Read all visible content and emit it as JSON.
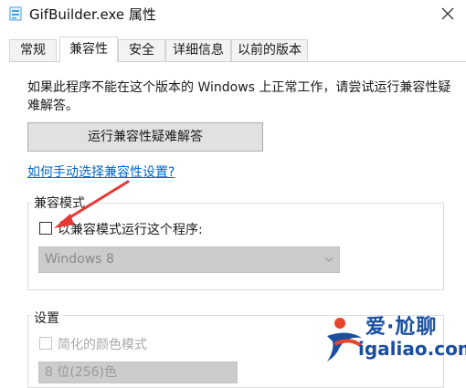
{
  "window": {
    "title": "GifBuilder.exe 属性",
    "app_icon": "app-icon",
    "close_icon": "close-icon"
  },
  "tabs": [
    {
      "label": "常规",
      "active": false
    },
    {
      "label": "兼容性",
      "active": true
    },
    {
      "label": "安全",
      "active": false
    },
    {
      "label": "详细信息",
      "active": false
    },
    {
      "label": "以前的版本",
      "active": false
    }
  ],
  "compat": {
    "description": "如果此程序不能在这个版本的 Windows 上正常工作，请尝试运行兼容性疑难解答。",
    "troubleshoot_button": "运行兼容性疑难解答",
    "help_link": "如何手动选择兼容性设置?",
    "mode_group_label": "兼容模式",
    "run_compat_checkbox_label": "以兼容模式运行这个程序:",
    "run_compat_checked": false,
    "os_select_value": "Windows 8",
    "settings_group_label": "设置",
    "reduced_color_label": "简化的颜色模式",
    "reduced_color_checked": false,
    "color_depth_value": "8 位(256)色"
  },
  "watermark": {
    "brand": "爱·尬聊",
    "url": "igaliao.com"
  },
  "colors": {
    "accent_link": "#0066cc",
    "arrow_red": "#e53935",
    "watermark_blue": "#1a4ea0"
  }
}
